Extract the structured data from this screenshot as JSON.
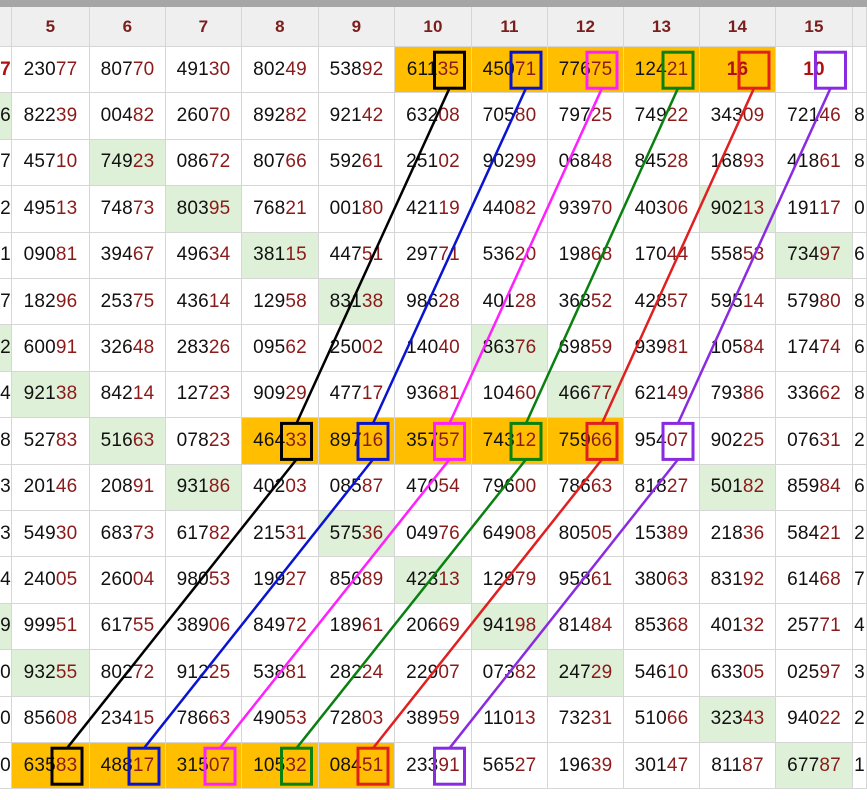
{
  "columns": [
    "",
    "5",
    "6",
    "7",
    "8",
    "9",
    "10",
    "11",
    "12",
    "13",
    "14",
    "15",
    ""
  ],
  "rows": [
    [
      "7",
      "23077",
      "80770",
      "49130",
      "80249",
      "53892",
      "61135",
      "45071",
      "77675",
      "12421",
      "16",
      "10",
      ""
    ],
    [
      "6",
      "82239",
      "00482",
      "26070",
      "89282",
      "92142",
      "63208",
      "70580",
      "79725",
      "74922",
      "34309",
      "72146",
      "8"
    ],
    [
      "7",
      "45710",
      "74923",
      "08672",
      "80766",
      "59261",
      "25102",
      "90299",
      "06848",
      "84528",
      "16893",
      "41861",
      "8"
    ],
    [
      "2",
      "49513",
      "74873",
      "80395",
      "76821",
      "00180",
      "42119",
      "44082",
      "93970",
      "40306",
      "90213",
      "19117",
      "0"
    ],
    [
      "1",
      "09081",
      "39467",
      "49634",
      "38115",
      "44751",
      "29771",
      "53620",
      "19868",
      "17044",
      "55853",
      "73497",
      "6"
    ],
    [
      "7",
      "18296",
      "25375",
      "43614",
      "12958",
      "83138",
      "98628",
      "40128",
      "36852",
      "42857",
      "59514",
      "57980",
      "8"
    ],
    [
      "2",
      "60091",
      "32648",
      "28326",
      "09562",
      "25002",
      "14040",
      "86376",
      "69859",
      "93981",
      "10584",
      "17474",
      "6"
    ],
    [
      "4",
      "92138",
      "84214",
      "12723",
      "90929",
      "47717",
      "93681",
      "10460",
      "46677",
      "62149",
      "79386",
      "33662",
      "8"
    ],
    [
      "8",
      "52783",
      "51663",
      "07823",
      "46433",
      "89716",
      "35757",
      "74312",
      "75966",
      "95407",
      "90225",
      "07631",
      "2"
    ],
    [
      "3",
      "20146",
      "20891",
      "93186",
      "40203",
      "08587",
      "47054",
      "79600",
      "78663",
      "81827",
      "50182",
      "85984",
      "6"
    ],
    [
      "3",
      "54930",
      "68373",
      "61782",
      "21531",
      "57536",
      "04976",
      "64908",
      "80505",
      "15389",
      "21836",
      "58421",
      "2"
    ],
    [
      "4",
      "24005",
      "26004",
      "98053",
      "19927",
      "85689",
      "42313",
      "12979",
      "95861",
      "38063",
      "83192",
      "61468",
      "7"
    ],
    [
      "9",
      "99951",
      "61755",
      "38906",
      "84972",
      "18961",
      "20669",
      "94198",
      "81484",
      "85368",
      "40132",
      "25771",
      "4"
    ],
    [
      "0",
      "93255",
      "80272",
      "91225",
      "53881",
      "28224",
      "22907",
      "07382",
      "24729",
      "54610",
      "63305",
      "02597",
      "3"
    ],
    [
      "0",
      "85608",
      "23415",
      "78663",
      "49053",
      "72803",
      "38959",
      "11013",
      "73231",
      "51066",
      "32343",
      "94022",
      "2"
    ],
    [
      "0",
      "63583",
      "48817",
      "31507",
      "10532",
      "08451",
      "23391",
      "56527",
      "19639",
      "30147",
      "81187",
      "67787",
      "1"
    ]
  ],
  "green_cells": [
    [
      1,
      0
    ],
    [
      2,
      2
    ],
    [
      3,
      3
    ],
    [
      3,
      10
    ],
    [
      4,
      4
    ],
    [
      4,
      11
    ],
    [
      5,
      5
    ],
    [
      6,
      0
    ],
    [
      6,
      7
    ],
    [
      7,
      1
    ],
    [
      7,
      8
    ],
    [
      8,
      2
    ],
    [
      9,
      3
    ],
    [
      9,
      10
    ],
    [
      10,
      5
    ],
    [
      11,
      6
    ],
    [
      12,
      0
    ],
    [
      12,
      7
    ],
    [
      13,
      1
    ],
    [
      13,
      8
    ],
    [
      14,
      10
    ],
    [
      15,
      11
    ]
  ],
  "gold_cells": [
    [
      0,
      6
    ],
    [
      0,
      7
    ],
    [
      0,
      8
    ],
    [
      0,
      9
    ],
    [
      0,
      10
    ],
    [
      8,
      4
    ],
    [
      8,
      5
    ],
    [
      8,
      6
    ],
    [
      8,
      7
    ],
    [
      8,
      8
    ],
    [
      15,
      1
    ],
    [
      15,
      2
    ],
    [
      15,
      3
    ],
    [
      15,
      4
    ],
    [
      15,
      5
    ]
  ],
  "chains": [
    {
      "color": "#000000",
      "cells": [
        [
          0,
          6
        ],
        [
          8,
          4
        ],
        [
          15,
          1
        ]
      ]
    },
    {
      "color": "#0a14d0",
      "cells": [
        [
          0,
          7
        ],
        [
          8,
          5
        ],
        [
          15,
          2
        ]
      ]
    },
    {
      "color": "#ff20ff",
      "cells": [
        [
          0,
          8
        ],
        [
          8,
          6
        ],
        [
          15,
          3
        ]
      ]
    },
    {
      "color": "#0a8010",
      "cells": [
        [
          0,
          9
        ],
        [
          8,
          7
        ],
        [
          15,
          4
        ]
      ]
    },
    {
      "color": "#e02020",
      "cells": [
        [
          0,
          10
        ],
        [
          8,
          8
        ],
        [
          15,
          5
        ]
      ]
    },
    {
      "color": "#8a2be2",
      "cells": [
        [
          0,
          11
        ],
        [
          8,
          9
        ],
        [
          15,
          6
        ]
      ]
    }
  ]
}
